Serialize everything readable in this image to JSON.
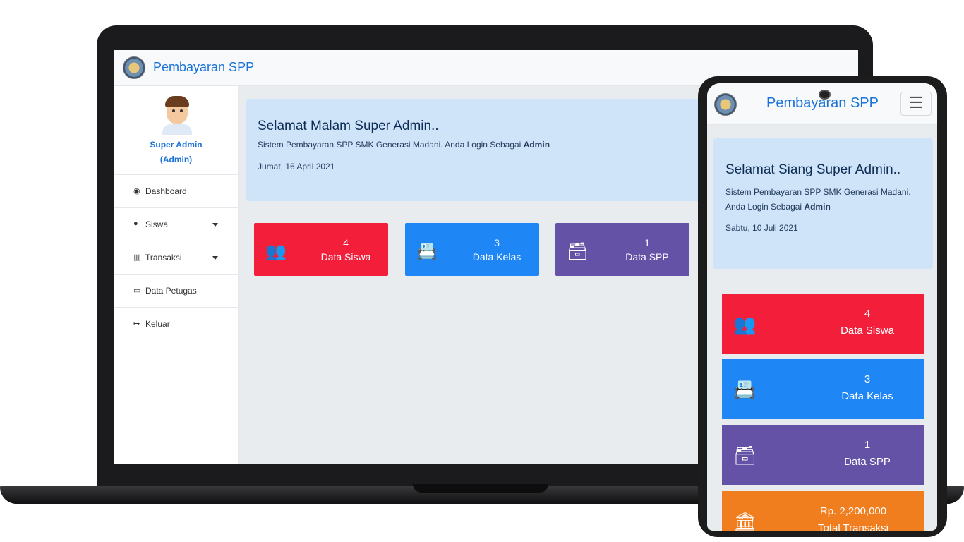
{
  "desktop": {
    "brand": "Pembayaran SPP",
    "user": {
      "name": "Super Admin",
      "role": "(Admin)"
    },
    "menu": [
      {
        "icon": "🚀",
        "label": "Dashboard"
      },
      {
        "icon": "👤",
        "label": "Siswa"
      },
      {
        "icon": "🏛",
        "label": "Transaksi"
      },
      {
        "icon": "🖥",
        "label": "Data Petugas"
      },
      {
        "icon": "⇥",
        "label": "Keluar"
      }
    ],
    "welcome": {
      "title": "Selamat Malam Super Admin..",
      "subtitle": "Sistem Pembayaran SPP SMK Generasi Madani. Anda Login Sebagai",
      "role": "Admin",
      "date": "Jumat, 16 April 2021"
    },
    "cards": [
      {
        "value": "4",
        "label": "Data Siswa",
        "color": "#f21e3a",
        "icon": "users-icon"
      },
      {
        "value": "3",
        "label": "Data Kelas",
        "color": "#1e86f5",
        "icon": "address-book-icon"
      },
      {
        "value": "1",
        "label": "Data SPP",
        "color": "#6352a6",
        "icon": "archive-icon"
      }
    ]
  },
  "mobile": {
    "brand": "Pembayaran SPP",
    "welcome": {
      "title": "Selamat Siang Super Admin..",
      "subtitle": "Sistem Pembayaran SPP SMK Generasi Madani. Anda Login Sebagai",
      "role": "Admin",
      "date": "Sabtu, 10 Juli 2021"
    },
    "cards": [
      {
        "value": "4",
        "label": "Data Siswa",
        "color": "#f21e3a",
        "icon": "users-icon"
      },
      {
        "value": "3",
        "label": "Data Kelas",
        "color": "#1e86f5",
        "icon": "address-book-icon"
      },
      {
        "value": "1",
        "label": "Data SPP",
        "color": "#6352a6",
        "icon": "archive-icon"
      },
      {
        "value": "Rp. 2,200,000",
        "label": "Total Transaksi",
        "color": "#f07d1e",
        "icon": "bank-icon"
      }
    ]
  }
}
